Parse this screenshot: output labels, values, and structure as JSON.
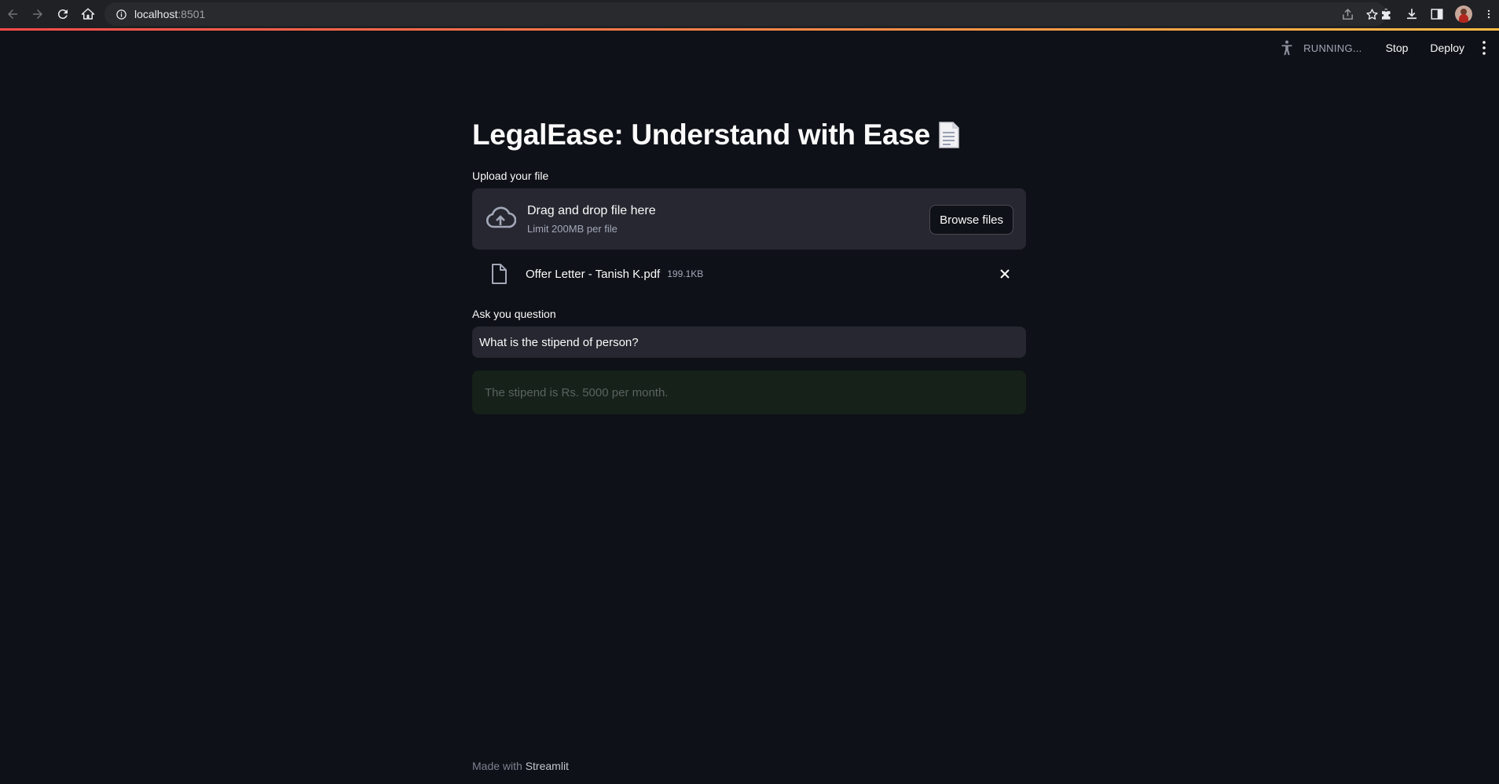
{
  "browser": {
    "url_host": "localhost",
    "url_port": ":8501"
  },
  "header": {
    "status": "RUNNING...",
    "stop_label": "Stop",
    "deploy_label": "Deploy"
  },
  "main": {
    "title": "LegalEase: Understand with Ease",
    "upload_label": "Upload your file",
    "dropzone_title": "Drag and drop file here",
    "dropzone_limit": "Limit 200MB per file",
    "browse_label": "Browse files",
    "file": {
      "name": "Offer Letter - Tanish K.pdf",
      "size": "199.1KB"
    },
    "question_label": "Ask you question",
    "question_value": "What is the stipend of person?",
    "answer": "The stipend is Rs. 5000 per month."
  },
  "footer": {
    "made_with": "Made with",
    "brand": "Streamlit"
  },
  "colors": {
    "background": "#0e1117",
    "widget": "#262730",
    "answer_bg": "#152119",
    "accent_start": "#ff4b4b",
    "accent_end": "#ffbd45"
  }
}
